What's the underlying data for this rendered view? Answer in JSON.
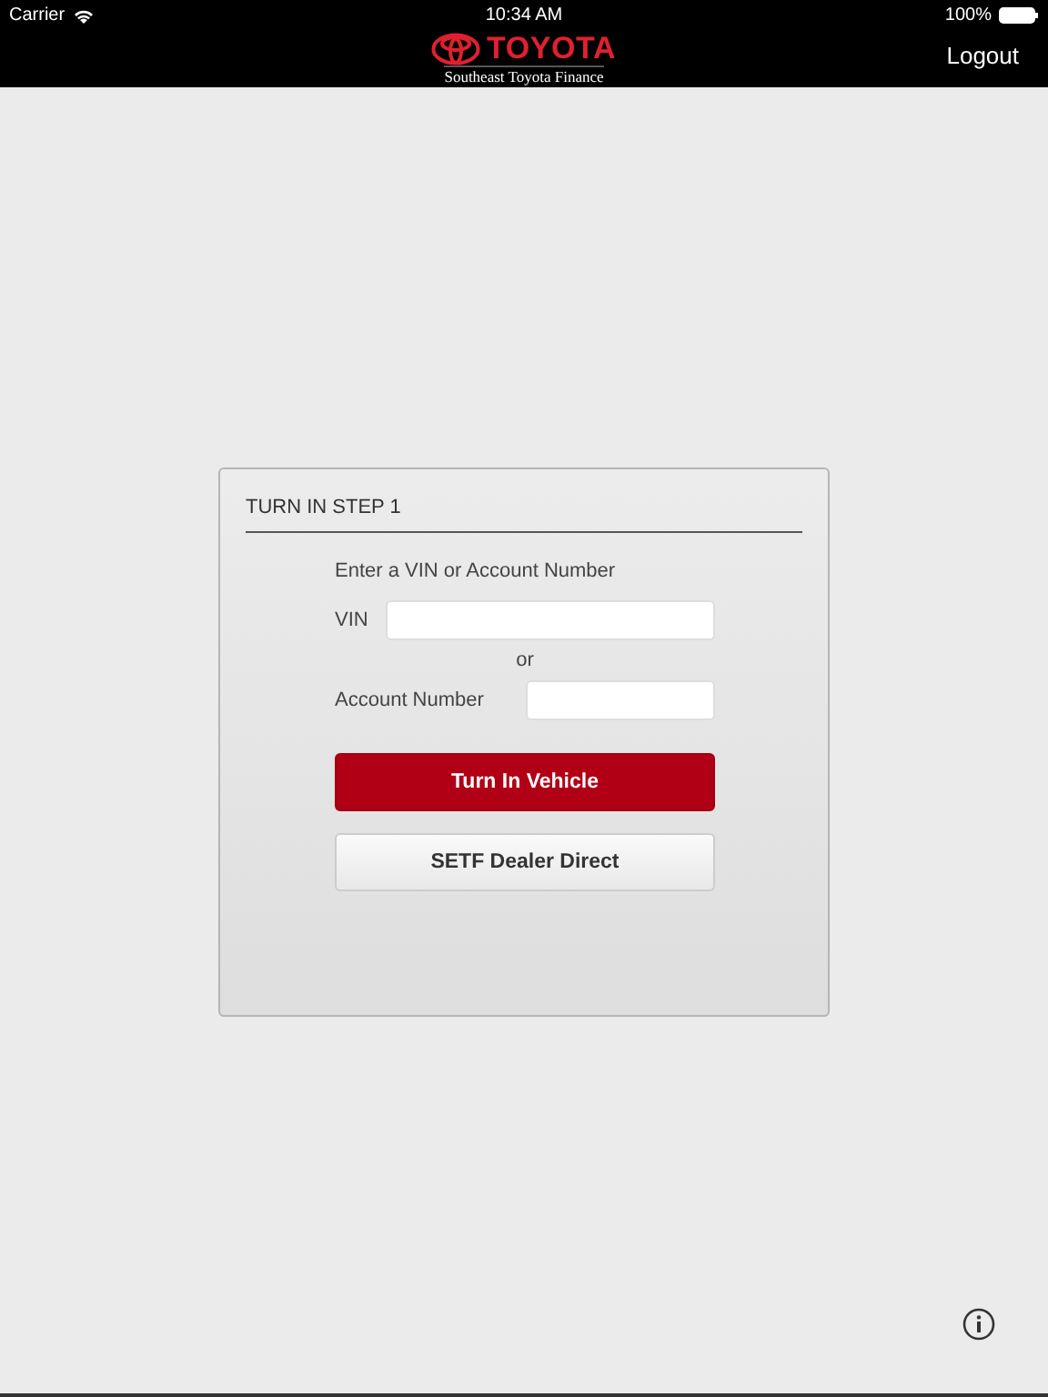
{
  "status_bar": {
    "carrier": "Carrier",
    "time": "10:34 AM",
    "battery": "100%"
  },
  "nav_bar": {
    "brand": "TOYOTA",
    "subtitle": "Southeast Toyota Finance",
    "action": "Logout"
  },
  "card": {
    "title": "TURN IN STEP 1",
    "instruction": "Enter a VIN or Account Number",
    "fields": [
      {
        "label": "VIN",
        "kind": "wide"
      },
      {
        "label": "Account Number",
        "kind": "narrow"
      }
    ],
    "separator": "or",
    "buttons": [
      {
        "label": "Turn In Vehicle",
        "kind": "primary"
      },
      {
        "label": "SETF Dealer Direct",
        "kind": "secondary"
      }
    ]
  }
}
